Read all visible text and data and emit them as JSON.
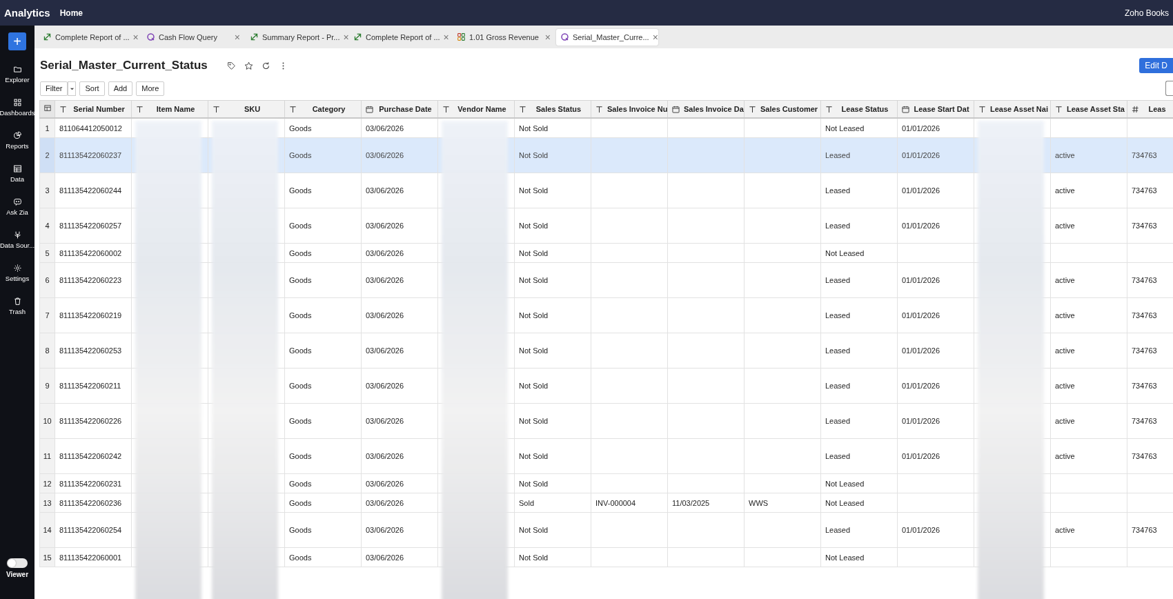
{
  "top_bar": {
    "app_name": "Analytics",
    "home_link": "Home",
    "org_name": "Zoho Books"
  },
  "sidebar": {
    "new_button": "+",
    "items": [
      {
        "label": "Explorer",
        "kind": "folder"
      },
      {
        "label": "Dashboards",
        "kind": "grid"
      },
      {
        "label": "Reports",
        "kind": "pie"
      },
      {
        "label": "Data",
        "kind": "table"
      },
      {
        "label": "Ask Zia",
        "kind": "bot"
      },
      {
        "label": "Data Sour...",
        "kind": "source"
      },
      {
        "label": "Settings",
        "kind": "gear"
      },
      {
        "label": "Trash",
        "kind": "trash"
      }
    ],
    "viewer_toggle": {
      "label": "Viewer",
      "on": false
    }
  },
  "tabs": [
    {
      "label": "Complete Report of ...",
      "kind": "report",
      "selected": false,
      "close": "×"
    },
    {
      "label": "Cash Flow Query",
      "kind": "query",
      "selected": false,
      "close": "×"
    },
    {
      "label": "Summary Report - Pr...",
      "kind": "report",
      "selected": false,
      "close": "×"
    },
    {
      "label": "Complete Report of ...",
      "kind": "report",
      "selected": false,
      "close": "×"
    },
    {
      "label": "1.01 Gross Revenue",
      "kind": "dashboard",
      "selected": false,
      "close": "×"
    },
    {
      "label": "Serial_Master_Curre...",
      "kind": "query",
      "selected": true,
      "close": "×"
    }
  ],
  "view": {
    "title": "Serial_Master_Current_Status",
    "edit_button": "Edit D",
    "toolbar": [
      "Filter",
      "Sort",
      "Add",
      "More"
    ]
  },
  "table": {
    "columns": [
      {
        "label": "Serial Number",
        "kind": "text",
        "redacted": false
      },
      {
        "label": "Item Name",
        "kind": "text",
        "redacted": true
      },
      {
        "label": "SKU",
        "kind": "text",
        "redacted": true
      },
      {
        "label": "Category",
        "kind": "text",
        "redacted": false
      },
      {
        "label": "Purchase Date",
        "kind": "date",
        "redacted": false
      },
      {
        "label": "Vendor Name",
        "kind": "text",
        "redacted": true
      },
      {
        "label": "Sales Status",
        "kind": "text",
        "redacted": false
      },
      {
        "label": "Sales Invoice Nu",
        "kind": "text",
        "redacted": false
      },
      {
        "label": "Sales Invoice Da",
        "kind": "date",
        "redacted": false
      },
      {
        "label": "Sales Customer",
        "kind": "text",
        "redacted": false
      },
      {
        "label": "Lease Status",
        "kind": "text",
        "redacted": false
      },
      {
        "label": "Lease Start Dat",
        "kind": "date",
        "redacted": false
      },
      {
        "label": "Lease Asset Nai",
        "kind": "text",
        "redacted": true
      },
      {
        "label": "Lease Asset Sta",
        "kind": "text",
        "redacted": false
      },
      {
        "label": "Leas",
        "kind": "number",
        "redacted": false
      }
    ],
    "rows": [
      {
        "number": "1",
        "selected": false,
        "tall": false,
        "cells": [
          "811064412050012",
          "",
          "",
          "Goods",
          "03/06/2026",
          "",
          "Not Sold",
          "",
          "",
          "",
          "Not Leased",
          "01/01/2026",
          "",
          "",
          ""
        ]
      },
      {
        "number": "2",
        "selected": true,
        "tall": true,
        "cells": [
          "811135422060237",
          "",
          "",
          "Goods",
          "03/06/2026",
          "",
          "Not Sold",
          "",
          "",
          "",
          "Leased",
          "01/01/2026",
          "",
          "active",
          "734763"
        ]
      },
      {
        "number": "3",
        "selected": false,
        "tall": true,
        "cells": [
          "811135422060244",
          "",
          "",
          "Goods",
          "03/06/2026",
          "",
          "Not Sold",
          "",
          "",
          "",
          "Leased",
          "01/01/2026",
          "",
          "active",
          "734763"
        ]
      },
      {
        "number": "4",
        "selected": false,
        "tall": true,
        "cells": [
          "811135422060257",
          "",
          "",
          "Goods",
          "03/06/2026",
          "",
          "Not Sold",
          "",
          "",
          "",
          "Leased",
          "01/01/2026",
          "",
          "active",
          "734763"
        ]
      },
      {
        "number": "5",
        "selected": false,
        "tall": false,
        "cells": [
          "811135422060002",
          "",
          "",
          "Goods",
          "03/06/2026",
          "",
          "Not Sold",
          "",
          "",
          "",
          "Not Leased",
          "",
          "",
          "",
          ""
        ]
      },
      {
        "number": "6",
        "selected": false,
        "tall": true,
        "cells": [
          "811135422060223",
          "",
          "",
          "Goods",
          "03/06/2026",
          "",
          "Not Sold",
          "",
          "",
          "",
          "Leased",
          "01/01/2026",
          "",
          "active",
          "734763"
        ]
      },
      {
        "number": "7",
        "selected": false,
        "tall": true,
        "cells": [
          "811135422060219",
          "",
          "",
          "Goods",
          "03/06/2026",
          "",
          "Not Sold",
          "",
          "",
          "",
          "Leased",
          "01/01/2026",
          "",
          "active",
          "734763"
        ]
      },
      {
        "number": "8",
        "selected": false,
        "tall": true,
        "cells": [
          "811135422060253",
          "",
          "",
          "Goods",
          "03/06/2026",
          "",
          "Not Sold",
          "",
          "",
          "",
          "Leased",
          "01/01/2026",
          "",
          "active",
          "734763"
        ]
      },
      {
        "number": "9",
        "selected": false,
        "tall": true,
        "cells": [
          "811135422060211",
          "",
          "",
          "Goods",
          "03/06/2026",
          "",
          "Not Sold",
          "",
          "",
          "",
          "Leased",
          "01/01/2026",
          "",
          "active",
          "734763"
        ]
      },
      {
        "number": "10",
        "selected": false,
        "tall": true,
        "cells": [
          "811135422060226",
          "",
          "",
          "Goods",
          "03/06/2026",
          "",
          "Not Sold",
          "",
          "",
          "",
          "Leased",
          "01/01/2026",
          "",
          "active",
          "734763"
        ]
      },
      {
        "number": "11",
        "selected": false,
        "tall": true,
        "cells": [
          "811135422060242",
          "",
          "",
          "Goods",
          "03/06/2026",
          "",
          "Not Sold",
          "",
          "",
          "",
          "Leased",
          "01/01/2026",
          "",
          "active",
          "734763"
        ]
      },
      {
        "number": "12",
        "selected": false,
        "tall": false,
        "cells": [
          "811135422060231",
          "",
          "",
          "Goods",
          "03/06/2026",
          "",
          "Not Sold",
          "",
          "",
          "",
          "Not Leased",
          "",
          "",
          "",
          ""
        ]
      },
      {
        "number": "13",
        "selected": false,
        "tall": false,
        "cells": [
          "811135422060236",
          "",
          "",
          "Goods",
          "03/06/2026",
          "",
          "Sold",
          "INV-000004",
          "11/03/2025",
          "WWS",
          "Not Leased",
          "",
          "",
          "",
          ""
        ]
      },
      {
        "number": "14",
        "selected": false,
        "tall": true,
        "cells": [
          "811135422060254",
          "",
          "",
          "Goods",
          "03/06/2026",
          "",
          "Not Sold",
          "",
          "",
          "",
          "Leased",
          "01/01/2026",
          "",
          "active",
          "734763"
        ]
      },
      {
        "number": "15",
        "selected": false,
        "tall": false,
        "cells": [
          "811135422060001",
          "",
          "",
          "Goods",
          "03/06/2026",
          "",
          "Not Sold",
          "",
          "",
          "",
          "Not Leased",
          "",
          "",
          "",
          ""
        ]
      }
    ]
  }
}
